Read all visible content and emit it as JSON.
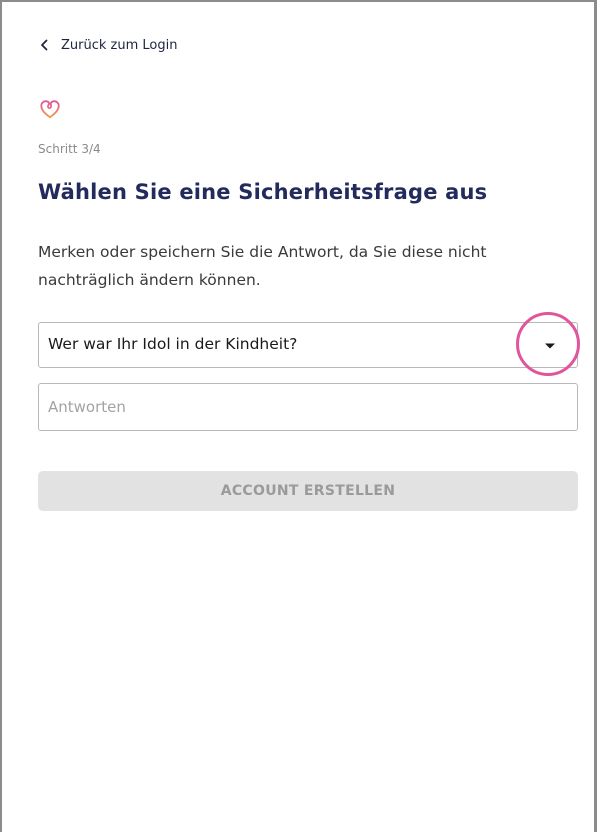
{
  "nav": {
    "back_label": "Zurück zum Login"
  },
  "header": {
    "logo_icon": "heart-icon",
    "step": "Schritt 3/4",
    "title": "Wählen Sie eine Sicherheitsfrage aus",
    "description": "Merken oder speichern Sie die Antwort, da Sie diese nicht nachträglich ändern können."
  },
  "form": {
    "question_select": {
      "value": "Wer war Ihr Idol in der Kindheit?",
      "caret_icon": "caret-down-icon"
    },
    "answer_input": {
      "value": "",
      "placeholder": "Antworten"
    },
    "submit_label": "ACCOUNT ERSTELLEN"
  },
  "colors": {
    "title": "#232a5c",
    "highlight": "#e0559b",
    "logo_gradient_start": "#e0559b",
    "logo_gradient_end": "#f29a4a",
    "button_disabled_bg": "#e2e2e2",
    "button_disabled_text": "#9a9a9a"
  }
}
